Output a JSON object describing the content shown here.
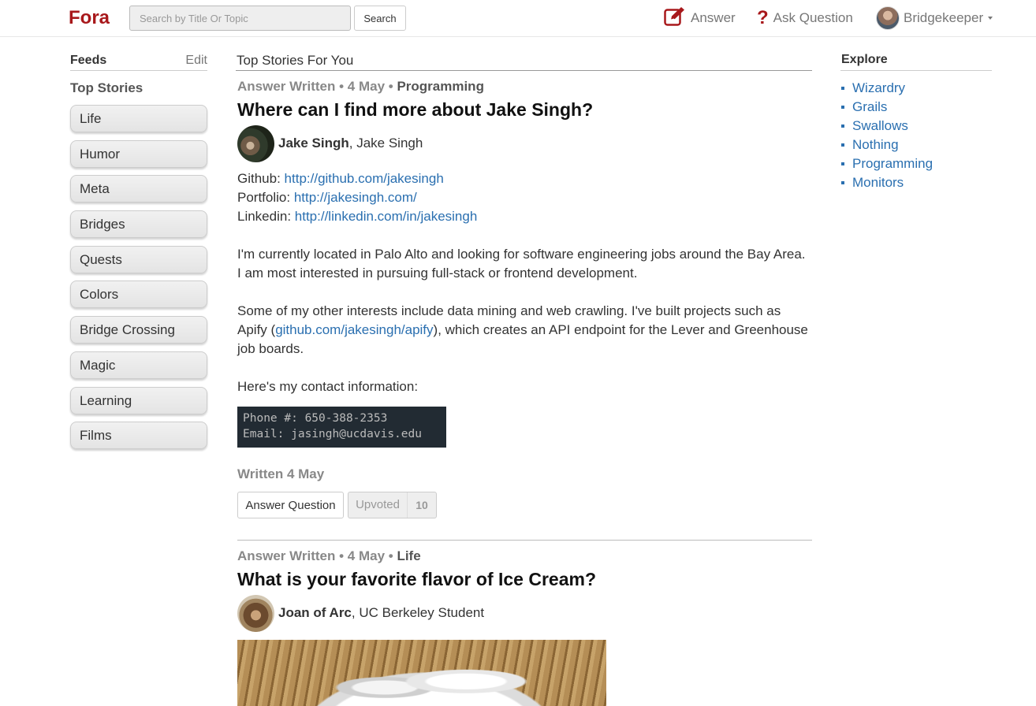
{
  "navbar": {
    "brand": "Fora",
    "search_placeholder": "Search by Title Or Topic",
    "search_button": "Search",
    "answer_label": "Answer",
    "ask_label": "Ask Question",
    "username": "Bridgekeeper",
    "brand_color": "#a8181b"
  },
  "sidebar": {
    "title": "Feeds",
    "edit": "Edit",
    "section": "Top Stories",
    "items": [
      "Life",
      "Humor",
      "Meta",
      "Bridges",
      "Quests",
      "Colors",
      "Bridge Crossing",
      "Magic",
      "Learning",
      "Films"
    ]
  },
  "main": {
    "heading": "Top Stories For You",
    "stories": [
      {
        "type": "Answer Written",
        "date": "4 May",
        "topic": "Programming",
        "title": "Where can I find more about Jake Singh?",
        "author": "Jake Singh",
        "credential": ", Jake Singh",
        "github_label": "Github: ",
        "github_url": "http://github.com/jakesingh",
        "portfolio_label": "Portfolio: ",
        "portfolio_url": "http://jakesingh.com/",
        "linkedin_label": "Linkedin: ",
        "linkedin_url": "http://linkedin.com/in/jakesingh",
        "para1": "I'm currently located in Palo Alto and looking for software engineering jobs around the Bay Area. I am most interested in pursuing full-stack or frontend development.",
        "para2_a": "Some of my other interests include data mining and web crawling. I've built projects such as Apify (",
        "para2_link": "github.com/jakesingh/apify",
        "para2_b": "), which creates an API endpoint for the Lever and Greenhouse job boards.",
        "para3": "Here's my contact information:",
        "code_line1": "Phone #: 650-388-2353",
        "code_line2": "Email: jasingh@ucdavis.edu",
        "written": "Written 4 May",
        "answer_button": "Answer Question",
        "upvote_label": "Upvoted",
        "upvote_count": "10"
      },
      {
        "type": "Answer Written",
        "date": "4 May",
        "topic": "Life",
        "title": "What is your favorite flavor of Ice Cream?",
        "author": "Joan of Arc",
        "credential": ", UC Berkeley Student"
      }
    ]
  },
  "explore": {
    "title": "Explore",
    "items": [
      "Wizardry",
      "Grails",
      "Swallows",
      "Nothing",
      "Programming",
      "Monitors"
    ]
  }
}
